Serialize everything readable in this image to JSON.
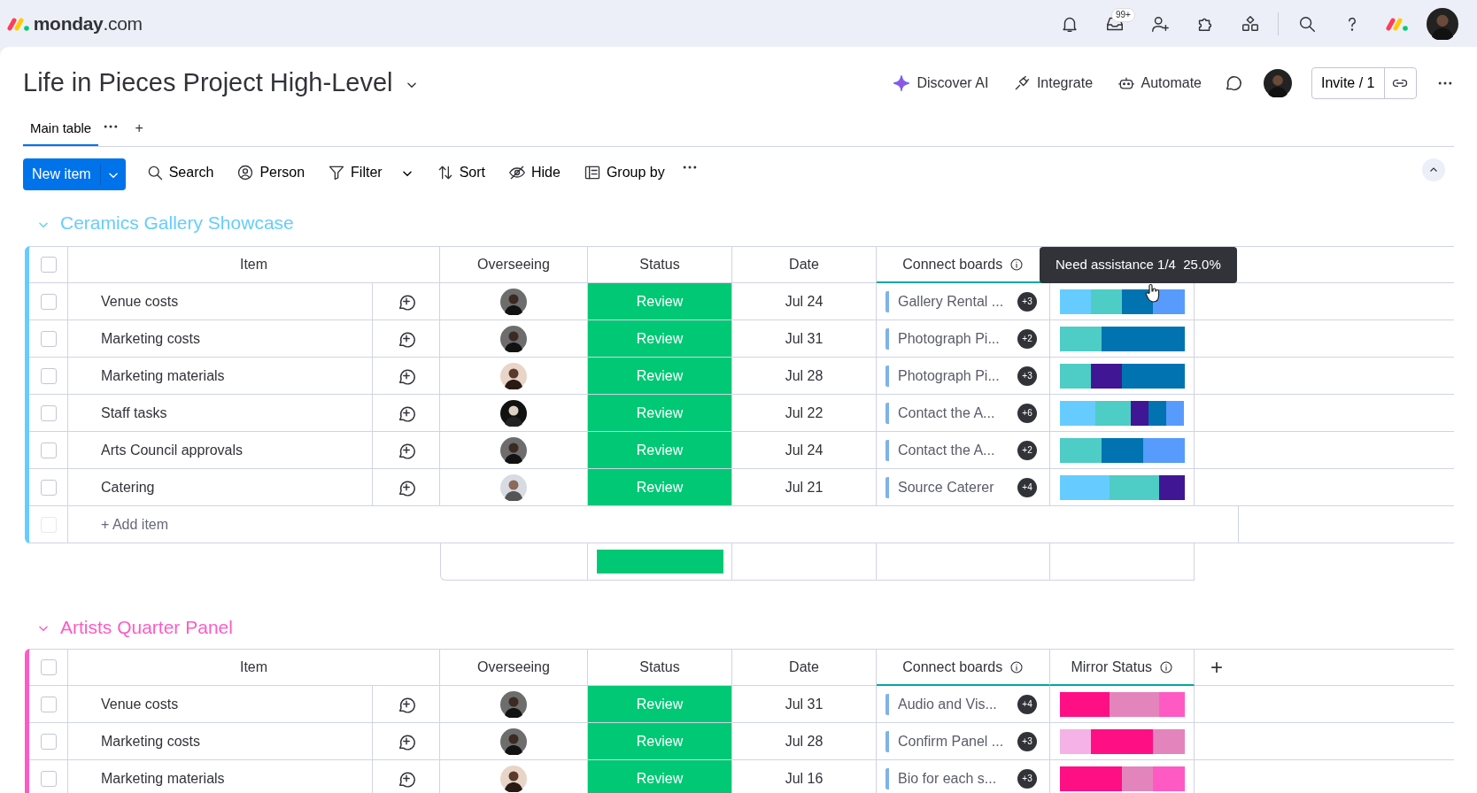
{
  "topbar": {
    "logo": "monday",
    "logo_domain": ".com",
    "inbox_badge": "99+"
  },
  "board": {
    "title": "Life in Pieces Project High-Level",
    "actions": [
      {
        "label": "Discover AI"
      },
      {
        "label": "Integrate"
      },
      {
        "label": "Automate"
      }
    ],
    "invite": "Invite / 1"
  },
  "views": [
    {
      "label": "Main table",
      "selected": true
    }
  ],
  "add_view": "+",
  "toolbar": {
    "new_item": "New item",
    "tools": [
      {
        "label": "Search",
        "dropdown": false
      },
      {
        "label": "Person",
        "dropdown": false
      },
      {
        "label": "Filter",
        "dropdown": true
      },
      {
        "label": "Sort",
        "dropdown": false
      },
      {
        "label": "Hide",
        "dropdown": false
      },
      {
        "label": "Group by",
        "dropdown": false
      }
    ]
  },
  "groups": [
    {
      "title": "Ceramics Gallery Showcase",
      "color": "#66ccff",
      "all_checked": false,
      "columns": [
        {
          "label": "Item",
          "info": false
        },
        {
          "label": "Overseeing",
          "info": false
        },
        {
          "label": "Status",
          "info": false
        },
        {
          "label": "Date",
          "info": false
        },
        {
          "label": "Connect boards",
          "info": true
        }
      ],
      "rows": [
        {
          "checked": false,
          "item": "Venue costs",
          "status": "Review",
          "date": "Jul 24",
          "link": "Gallery Rental ...",
          "link_count": "+3",
          "mirror": [
            {
              "color": "#66ccff"
            },
            {
              "color": "#4eccc6"
            },
            {
              "color": "#0073b0"
            },
            {
              "color": "#579bfc"
            }
          ]
        },
        {
          "checked": false,
          "item": "Marketing costs",
          "status": "Review",
          "date": "Jul 31",
          "link": "Photograph Pi...",
          "link_count": "+2",
          "mirror": [
            {
              "color": "#4eccc6"
            },
            {
              "color": "#0073b0"
            },
            {
              "color": "#0073b0"
            }
          ]
        },
        {
          "checked": false,
          "item": "Marketing materials",
          "status": "Review",
          "date": "Jul 28",
          "link": "Photograph Pi...",
          "link_count": "+3",
          "mirror": [
            {
              "color": "#4eccc6"
            },
            {
              "color": "#401694"
            },
            {
              "color": "#0073b0"
            },
            {
              "color": "#0073b0"
            }
          ]
        },
        {
          "checked": false,
          "item": "Staff tasks",
          "status": "Review",
          "date": "Jul 22",
          "link": "Contact the A...",
          "link_count": "+6",
          "mirror": [
            {
              "color": "#66ccff"
            },
            {
              "color": "#66ccff"
            },
            {
              "color": "#4eccc6"
            },
            {
              "color": "#4eccc6"
            },
            {
              "color": "#401694"
            },
            {
              "color": "#0073b0"
            },
            {
              "color": "#579bfc"
            }
          ]
        },
        {
          "checked": false,
          "item": "Arts Council approvals",
          "status": "Review",
          "date": "Jul 24",
          "link": "Contact the A...",
          "link_count": "+2",
          "mirror": [
            {
              "color": "#4eccc6"
            },
            {
              "color": "#0073b0"
            },
            {
              "color": "#579bfc"
            }
          ]
        },
        {
          "checked": false,
          "item": "Catering",
          "status": "Review",
          "date": "Jul 21",
          "link": "Source Caterer",
          "link_count": "+4",
          "mirror": [
            {
              "color": "#66ccff"
            },
            {
              "color": "#66ccff"
            },
            {
              "color": "#4eccc6"
            },
            {
              "color": "#4eccc6"
            },
            {
              "color": "#401694"
            }
          ]
        }
      ],
      "add_item": "+ Add item",
      "add_item_checked": false,
      "status_summary": [
        {
          "color": "#00c875",
          "level": 1
        }
      ],
      "tooltip": "Need assistance 1/4  25.0%"
    },
    {
      "title": "Artists Quarter Panel",
      "color": "#ff5ac4",
      "all_checked": false,
      "columns": [
        {
          "label": "Item",
          "info": false
        },
        {
          "label": "Overseeing",
          "info": false
        },
        {
          "label": "Status",
          "info": false
        },
        {
          "label": "Date",
          "info": false
        },
        {
          "label": "Connect boards",
          "info": true
        },
        {
          "label": "Mirror Status",
          "info": true
        }
      ],
      "add_column": "+",
      "rows": [
        {
          "checked": false,
          "item": "Venue costs",
          "status": "Review",
          "date": "Jul 31",
          "link": "Audio and Vis...",
          "link_count": "+4",
          "mirror": [
            {
              "color": "#ff0f83"
            },
            {
              "color": "#ff0f83"
            },
            {
              "color": "#e484bd"
            },
            {
              "color": "#e484bd"
            },
            {
              "color": "#ff5ac4"
            }
          ]
        },
        {
          "checked": false,
          "item": "Marketing costs",
          "status": "Review",
          "date": "Jul 28",
          "link": "Confirm Panel ...",
          "link_count": "+3",
          "mirror": [
            {
              "color": "#f4b2e6"
            },
            {
              "color": "#ff0f83"
            },
            {
              "color": "#ff0f83"
            },
            {
              "color": "#e484bd"
            }
          ]
        },
        {
          "checked": false,
          "item": "Marketing materials",
          "status": "Review",
          "date": "Jul 16",
          "link": "Bio for each s...",
          "link_count": "+3",
          "mirror": [
            {
              "color": "#ff0f83"
            },
            {
              "color": "#ff0f83"
            },
            {
              "color": "#e484bd"
            },
            {
              "color": "#ff5ac4"
            }
          ]
        }
      ]
    }
  ]
}
